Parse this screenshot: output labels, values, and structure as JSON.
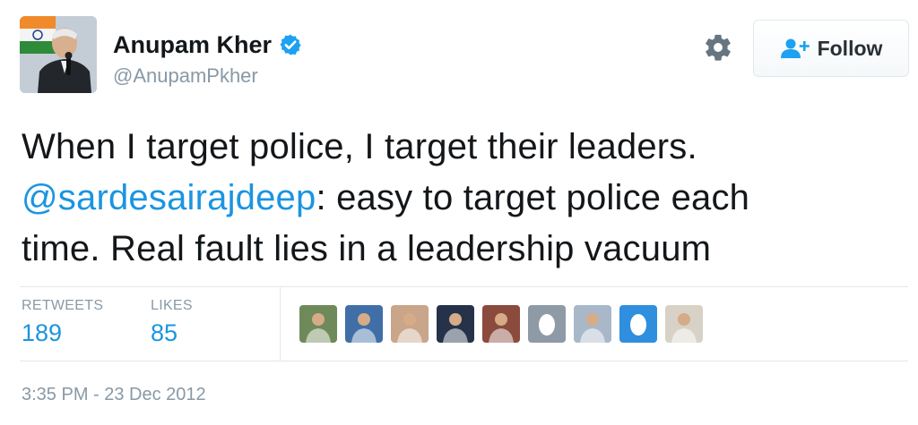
{
  "user": {
    "full_name": "Anupam Kher",
    "screen_name": "@AnupamPkher",
    "verified": true
  },
  "actions": {
    "follow_label": "Follow"
  },
  "tweet": {
    "line1": "When I target police, I target their leaders.",
    "mention": "@sardesairajdeep",
    "line2_rest": ": easy to target police each",
    "line3": "time. Real fault lies in a leadership vacuum"
  },
  "stats": {
    "retweets_label": "RETWEETS",
    "retweets_value": "189",
    "likes_label": "LIKES",
    "likes_value": "85"
  },
  "likers": [
    {
      "kind": "photo",
      "bg": "#6f8a5a"
    },
    {
      "kind": "photo",
      "bg": "#3f6fa6"
    },
    {
      "kind": "photo",
      "bg": "#c9a58a"
    },
    {
      "kind": "photo",
      "bg": "#25324a"
    },
    {
      "kind": "photo",
      "bg": "#8a4b3c"
    },
    {
      "kind": "egg",
      "bg": "#8e9aa6"
    },
    {
      "kind": "photo",
      "bg": "#a8b8c8"
    },
    {
      "kind": "egg",
      "bg": "#2f8fde"
    },
    {
      "kind": "photo",
      "bg": "#d8d2c6"
    }
  ],
  "timestamp": "3:35 PM - 23 Dec 2012",
  "colors": {
    "link": "#1b95e0",
    "muted": "#8899a6",
    "text": "#14171a",
    "border": "#e1e8ed"
  }
}
